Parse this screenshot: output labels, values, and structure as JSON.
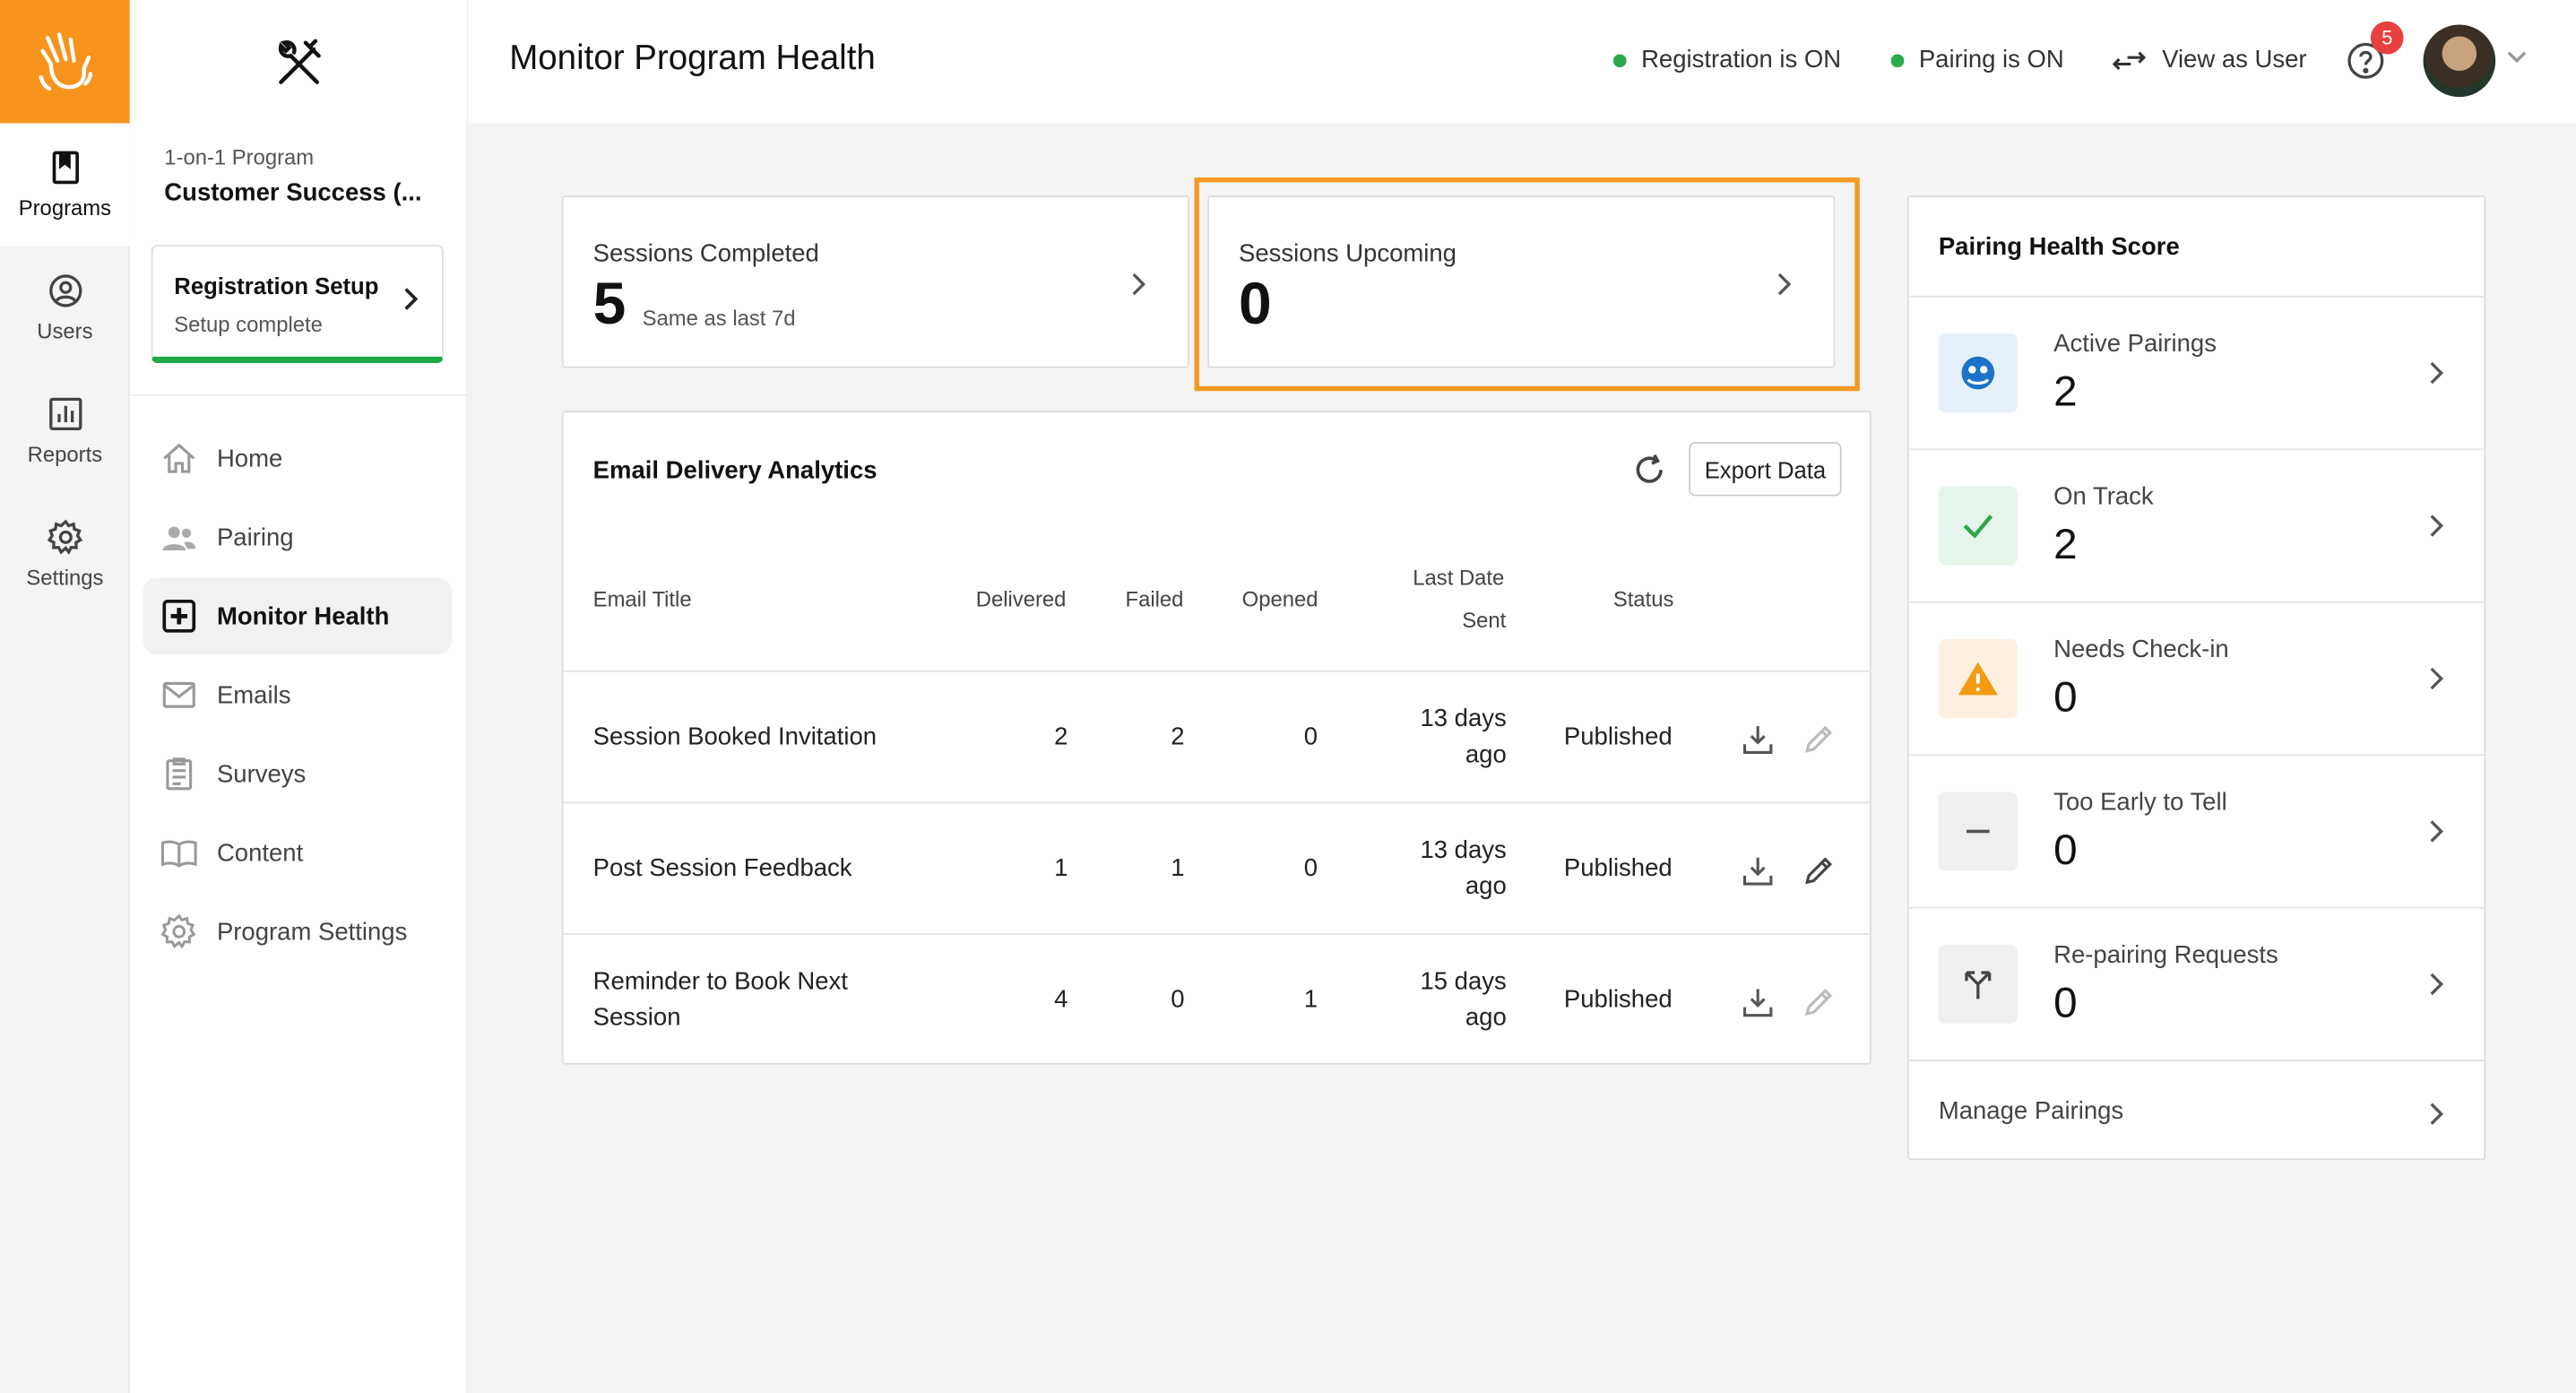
{
  "rail": {
    "items": [
      {
        "label": "Programs",
        "icon": "bookmark-icon"
      },
      {
        "label": "Users",
        "icon": "user-circle-icon"
      },
      {
        "label": "Reports",
        "icon": "bar-chart-icon"
      },
      {
        "label": "Settings",
        "icon": "gear-icon"
      }
    ]
  },
  "sidebar": {
    "program_type": "1-on-1 Program",
    "program_name": "Customer Success (...",
    "registration": {
      "title": "Registration Setup",
      "subtitle": "Setup complete"
    },
    "nav": [
      {
        "label": "Home",
        "icon": "home-icon"
      },
      {
        "label": "Pairing",
        "icon": "people-icon"
      },
      {
        "label": "Monitor Health",
        "icon": "health-plus-icon"
      },
      {
        "label": "Emails",
        "icon": "mail-icon"
      },
      {
        "label": "Surveys",
        "icon": "clipboard-icon"
      },
      {
        "label": "Content",
        "icon": "book-icon"
      },
      {
        "label": "Program Settings",
        "icon": "gear-icon"
      }
    ]
  },
  "header": {
    "title": "Monitor Program Health",
    "registration_status": "Registration is ON",
    "pairing_status": "Pairing is ON",
    "view_as_user": "View as User",
    "notification_count": "5"
  },
  "stats": {
    "completed": {
      "label": "Sessions Completed",
      "value": "5",
      "sub": "Same as last 7d"
    },
    "upcoming": {
      "label": "Sessions Upcoming",
      "value": "0"
    }
  },
  "email_analytics": {
    "title": "Email Delivery Analytics",
    "export_label": "Export Data",
    "columns": {
      "title": "Email Title",
      "delivered": "Delivered",
      "failed": "Failed",
      "opened": "Opened",
      "last_date_1": "Last Date",
      "last_date_2": "Sent",
      "status": "Status"
    },
    "rows": [
      {
        "title_1": "Session Booked Invitation",
        "title_2": "",
        "delivered": "2",
        "failed": "2",
        "opened": "0",
        "date_1": "13 days",
        "date_2": "ago",
        "status": "Published"
      },
      {
        "title_1": "Post Session Feedback",
        "title_2": "",
        "delivered": "1",
        "failed": "1",
        "opened": "0",
        "date_1": "13 days",
        "date_2": "ago",
        "status": "Published"
      },
      {
        "title_1": "Reminder to Book Next",
        "title_2": "Session",
        "delivered": "4",
        "failed": "0",
        "opened": "1",
        "date_1": "15 days",
        "date_2": "ago",
        "status": "Published"
      }
    ]
  },
  "pairing_health": {
    "title": "Pairing Health Score",
    "rows": [
      {
        "label": "Active Pairings",
        "value": "2",
        "icon": "pairing-faces-icon",
        "color": "#1a73c8",
        "bg": "#e6f0fa"
      },
      {
        "label": "On Track",
        "value": "2",
        "icon": "check-icon",
        "color": "#2aa84a",
        "bg": "#e6f5ea"
      },
      {
        "label": "Needs Check-in",
        "value": "0",
        "icon": "warning-icon",
        "color": "#f39c12",
        "bg": "#fdf0e0"
      },
      {
        "label": "Too Early to Tell",
        "value": "0",
        "icon": "minus-icon",
        "color": "#555555",
        "bg": "#efefef"
      },
      {
        "label": "Re-pairing Requests",
        "value": "0",
        "icon": "split-arrows-icon",
        "color": "#444444",
        "bg": "#efefef"
      }
    ],
    "manage_label": "Manage Pairings"
  },
  "colors": {
    "brand": "#f7941d",
    "highlight": "#f59a23",
    "status_on": "#2ca84d",
    "badge": "#e84040"
  }
}
